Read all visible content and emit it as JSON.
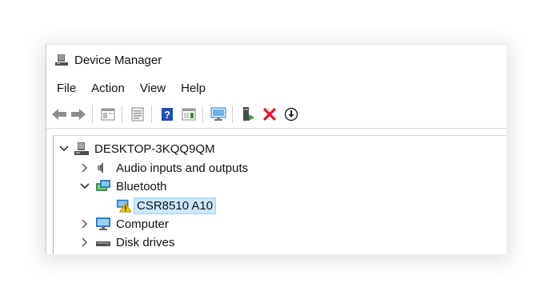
{
  "window": {
    "title": "Device Manager",
    "icon": "device-manager-icon"
  },
  "menu": {
    "items": [
      {
        "label": "File"
      },
      {
        "label": "Action"
      },
      {
        "label": "View"
      },
      {
        "label": "Help"
      }
    ]
  },
  "toolbar": {
    "buttons": [
      {
        "name": "back-icon"
      },
      {
        "name": "forward-icon"
      },
      {
        "name": "show-hide-console-tree-icon"
      },
      {
        "name": "properties-icon"
      },
      {
        "name": "help-icon"
      },
      {
        "name": "show-action-pane-icon"
      },
      {
        "name": "scan-hardware-icon"
      },
      {
        "name": "update-driver-icon"
      },
      {
        "name": "uninstall-icon"
      },
      {
        "name": "disable-device-icon"
      }
    ]
  },
  "tree": {
    "root": {
      "label": "DESKTOP-3KQQ9QM",
      "icon": "computer-tower-icon",
      "expanded": true
    },
    "nodes": [
      {
        "label": "Audio inputs and outputs",
        "icon": "speaker-icon",
        "expanded": false
      },
      {
        "label": "Bluetooth",
        "icon": "bluetooth-adapter-icon",
        "expanded": true,
        "children": [
          {
            "label": "CSR8510 A10",
            "icon": "bluetooth-device-warning-icon",
            "selected": true
          }
        ]
      },
      {
        "label": "Computer",
        "icon": "monitor-icon",
        "expanded": false
      },
      {
        "label": "Disk drives",
        "icon": "disk-drive-icon",
        "expanded": false
      }
    ]
  },
  "colors": {
    "selection_bg": "#cce8ff",
    "selection_border": "#99d1ff",
    "uninstall_red": "#e81123",
    "help_blue": "#1e50b4",
    "warning_yellow": "#f5c400"
  }
}
